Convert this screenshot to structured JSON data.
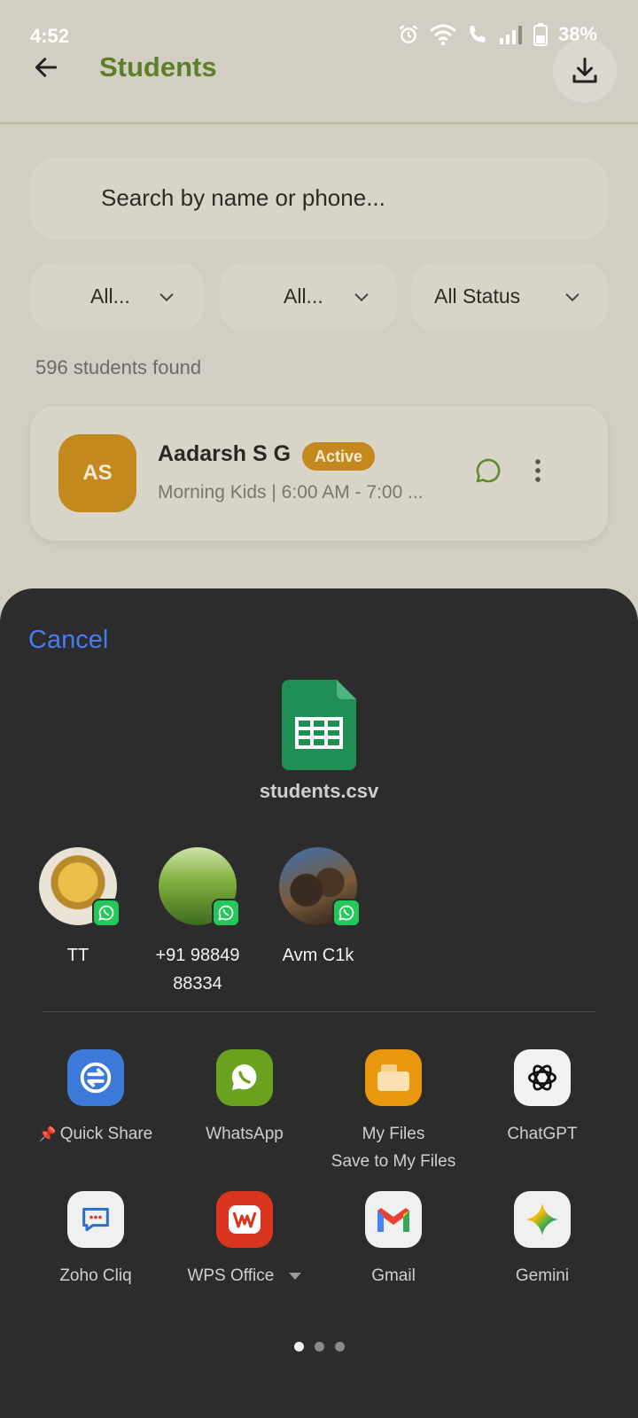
{
  "status_bar": {
    "time": "4:52",
    "battery": "38%"
  },
  "app_bar": {
    "title": "Students"
  },
  "search": {
    "placeholder": "Search by name or phone..."
  },
  "filters": [
    {
      "label": "All..."
    },
    {
      "label": "All..."
    },
    {
      "label": "All Status"
    }
  ],
  "results": {
    "count_text": "596 students found"
  },
  "student": {
    "initials": "AS",
    "name": "Aadarsh S G",
    "status": "Active",
    "batch": "Morning Kids | 6:00 AM - 7:00 ..."
  },
  "share_sheet": {
    "cancel_label": "Cancel",
    "file_name": "students.csv",
    "contacts": [
      {
        "name": "TT",
        "app_badge": "whatsapp-icon"
      },
      {
        "name_line1": "+91 98849",
        "name_line2": "88334",
        "app_badge": "whatsapp-icon"
      },
      {
        "name": "Avm C1k",
        "app_badge": "whatsapp-icon"
      }
    ],
    "apps_row1": [
      {
        "label": "Quick Share",
        "icon": "quick-share-icon",
        "pinned": true
      },
      {
        "label": "WhatsApp",
        "icon": "whatsapp-icon"
      },
      {
        "label": "My Files",
        "sublabel": "Save to My Files",
        "icon": "my-files-icon"
      },
      {
        "label": "ChatGPT",
        "icon": "chatgpt-icon"
      }
    ],
    "apps_row2": [
      {
        "label": "Zoho Cliq",
        "icon": "zoho-cliq-icon"
      },
      {
        "label": "WPS Office",
        "icon": "wps-office-icon",
        "has_dropdown": true
      },
      {
        "label": "Gmail",
        "icon": "gmail-icon"
      },
      {
        "label": "Gemini",
        "icon": "gemini-icon"
      }
    ],
    "pages": {
      "total": 3,
      "current": 1
    }
  },
  "colors": {
    "title_green": "#5d7f28",
    "badge_amber": "#c4891e",
    "cancel_blue": "#4a7bf0",
    "sheet_bg": "#2c2c2c"
  }
}
